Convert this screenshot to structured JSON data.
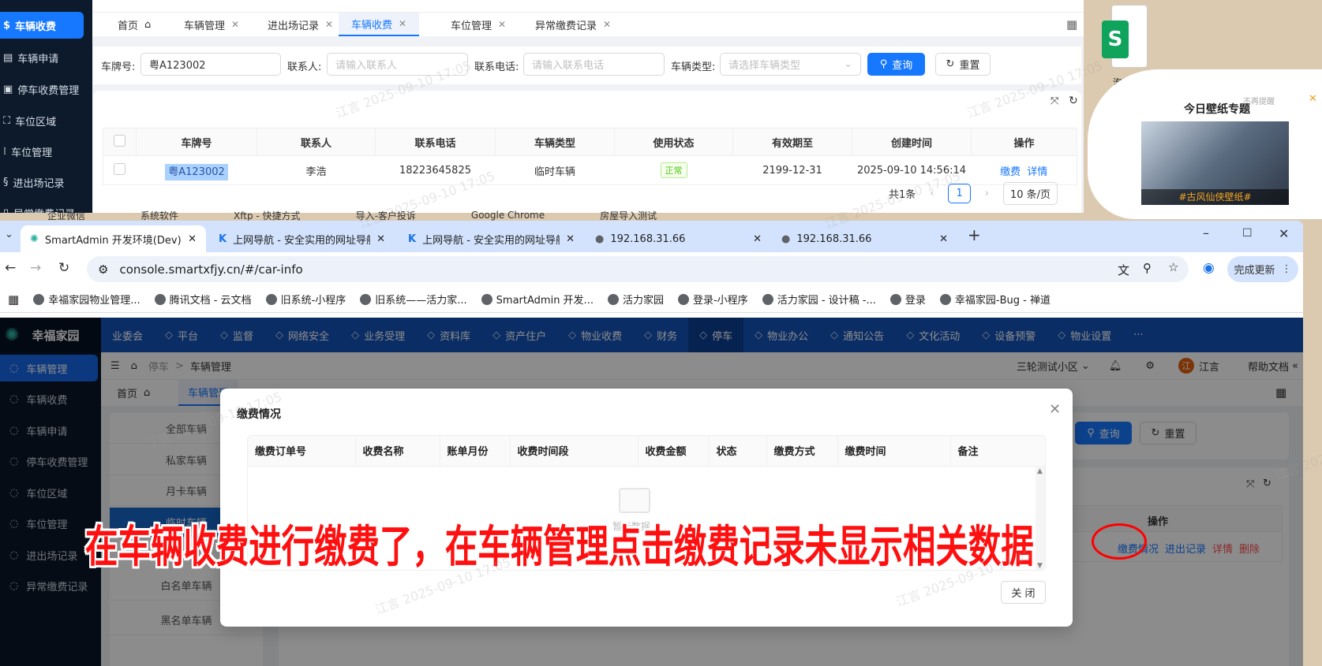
{
  "colors": {
    "accent": "#1677ff",
    "sidebar": "#0c1a2c",
    "nav": "#1353b8",
    "annotation": "#ff1010",
    "success": "#52c41a",
    "danger": "#ff4d4f"
  },
  "watermark": "江言 2025-09-10 17:05",
  "top_window": {
    "sidebar": [
      {
        "label": "车辆收费",
        "icon": "dollar-circle-icon",
        "active": true
      },
      {
        "label": "车辆申请",
        "icon": "form-icon"
      },
      {
        "label": "停车收费管理",
        "icon": "calendar-icon"
      },
      {
        "label": "车位区域",
        "icon": "area-icon"
      },
      {
        "label": "车位管理",
        "icon": "grid-dots-icon"
      },
      {
        "label": "进出场记录",
        "icon": "route-icon"
      },
      {
        "label": "异常缴费记录",
        "icon": "file-alert-icon"
      }
    ],
    "tabs": [
      {
        "label": "首页",
        "home": true
      },
      {
        "label": "车辆管理"
      },
      {
        "label": "进出场记录"
      },
      {
        "label": "车辆收费",
        "active": true
      },
      {
        "label": "车位管理"
      },
      {
        "label": "异常缴费记录"
      }
    ],
    "search": {
      "plate_label": "车牌号:",
      "plate_value": "粤A123002",
      "contact_label": "联系人:",
      "contact_placeholder": "请输入联系人",
      "phone_label": "联系电话:",
      "phone_placeholder": "请输入联系电话",
      "type_label": "车辆类型:",
      "type_placeholder": "请选择车辆类型",
      "query": "查询",
      "reset": "重置"
    },
    "table": {
      "columns": [
        "车牌号",
        "联系人",
        "联系电话",
        "车辆类型",
        "使用状态",
        "有效期至",
        "创建时间",
        "操作"
      ],
      "rows": [
        {
          "plate": "粤A123002",
          "contact": "李浩",
          "phone": "18223645825",
          "type": "临时车辆",
          "status": "正常",
          "expire": "2199-12-31",
          "created": "2025-09-10 14:56:14",
          "actions": [
            "缴费",
            "详情"
          ]
        }
      ]
    },
    "pagination": {
      "total": "共1条",
      "current": "1",
      "page_size": "10 条/页"
    }
  },
  "desktop": {
    "file_label": "泡bug",
    "taskbar_labels": [
      "企业微信",
      "系统软件",
      "Xftp - 快捷方式",
      "导入-客户投诉",
      "Google Chrome",
      "房屋导入测试"
    ],
    "popup": {
      "dismiss": "不再提醒",
      "title": "今日壁纸专题",
      "caption": "#古风仙侠壁纸#"
    }
  },
  "browser": {
    "tabs": [
      {
        "title": "SmartAdmin 开发环境(Dev)",
        "icon": "snowflake-icon",
        "active": true
      },
      {
        "title": "上网导航 - 安全实用的网址导航",
        "icon": "k-shield-icon"
      },
      {
        "title": "上网导航 - 安全实用的网址导航",
        "icon": "k-shield-icon"
      },
      {
        "title": "192.168.31.66",
        "icon": "globe-icon"
      },
      {
        "title": "192.168.31.66",
        "icon": "globe-icon"
      }
    ],
    "url": "console.smartxfjy.cn/#/car-info",
    "update_label": "完成更新",
    "bookmarks": [
      "幸福家园物业管理...",
      "腾讯文档 - 云文档",
      "旧系统-小程序",
      "旧系统——活力家...",
      "SmartAdmin 开发...",
      "活力家园",
      "登录-小程序",
      "活力家园 - 设计稿 -...",
      "登录",
      "幸福家园-Bug - 禅道"
    ]
  },
  "app": {
    "logo": "幸福家园",
    "nav": [
      {
        "label": "业委会"
      },
      {
        "label": "平台"
      },
      {
        "label": "监督"
      },
      {
        "label": "网络安全"
      },
      {
        "label": "业务受理"
      },
      {
        "label": "资料库"
      },
      {
        "label": "资产住户"
      },
      {
        "label": "物业收费"
      },
      {
        "label": "财务"
      },
      {
        "label": "停车",
        "active": true
      },
      {
        "label": "物业办公"
      },
      {
        "label": "通知公告"
      },
      {
        "label": "文化活动"
      },
      {
        "label": "设备预警"
      },
      {
        "label": "物业设置"
      },
      {
        "label": "···"
      }
    ],
    "sidebar": [
      {
        "label": "车辆管理",
        "active": true
      },
      {
        "label": "车辆收费"
      },
      {
        "label": "车辆申请"
      },
      {
        "label": "停车收费管理"
      },
      {
        "label": "车位区域"
      },
      {
        "label": "车位管理"
      },
      {
        "label": "进出场记录"
      },
      {
        "label": "异常缴费记录"
      }
    ],
    "breadcrumb": [
      "停车",
      "车辆管理"
    ],
    "community": "三轮测试小区",
    "avatar": "江",
    "user": "江言",
    "help": "帮助文档",
    "tabs": [
      "首页",
      "车辆管理"
    ],
    "categories": [
      "全部车辆",
      "私家车辆",
      "月卡车辆",
      "临时车辆",
      "白名单车辆",
      "黑名单车辆"
    ],
    "active_category": "临时车辆",
    "query": "查询",
    "reset": "重置",
    "actions_header": "操作",
    "row_actions": [
      "缴费情况",
      "进出记录",
      "详情",
      "删除"
    ]
  },
  "modal": {
    "title": "缴费情况",
    "columns": [
      "缴费订单号",
      "收费名称",
      "账单月份",
      "收费时间段",
      "收费金额",
      "状态",
      "缴费方式",
      "缴费时间",
      "备注"
    ],
    "empty_text": "暂无数据",
    "close": "关 闭"
  },
  "annotation": "在车辆收费进行缴费了，在车辆管理点击缴费记录未显示相关数据"
}
